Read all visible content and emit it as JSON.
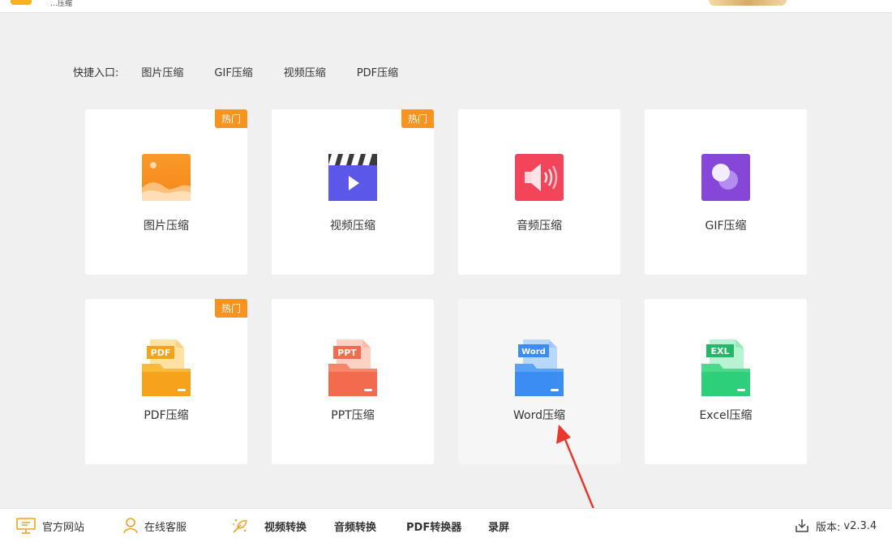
{
  "header": {
    "title_stub": "…压缩"
  },
  "quick_entry": {
    "label": "快捷入口:",
    "links": [
      "图片压缩",
      "GIF压缩",
      "视频压缩",
      "PDF压缩"
    ]
  },
  "cards": [
    {
      "label": "图片压缩",
      "badge": "热门",
      "icon": "image-icon"
    },
    {
      "label": "视频压缩",
      "badge": "热门",
      "icon": "video-icon"
    },
    {
      "label": "音频压缩",
      "badge": "",
      "icon": "audio-icon"
    },
    {
      "label": "GIF压缩",
      "badge": "",
      "icon": "gif-icon"
    },
    {
      "label": "PDF压缩",
      "badge": "热门",
      "icon": "pdf-folder-icon",
      "tag": "PDF"
    },
    {
      "label": "PPT压缩",
      "badge": "",
      "icon": "ppt-folder-icon",
      "tag": "PPT"
    },
    {
      "label": "Word压缩",
      "badge": "",
      "icon": "word-folder-icon",
      "tag": "Word"
    },
    {
      "label": "Excel压缩",
      "badge": "",
      "icon": "excel-folder-icon",
      "tag": "EXL"
    }
  ],
  "bottom": {
    "website": "官方网站",
    "support": "在线客服",
    "video_convert": "视频转换",
    "audio_convert": "音频转换",
    "pdf_convert": "PDF转换器",
    "record": "录屏",
    "version_label": "版本:",
    "version": "v2.3.4"
  },
  "colors": {
    "accent": "#f7931e",
    "image": "#f7931e",
    "video": "#5b57e8",
    "audio": "#f2455a",
    "gif": "#8647d9",
    "pdf": "#f6a21c",
    "ppt": "#f36b4e",
    "word": "#3b8cf3",
    "excel": "#2ecf7a"
  }
}
